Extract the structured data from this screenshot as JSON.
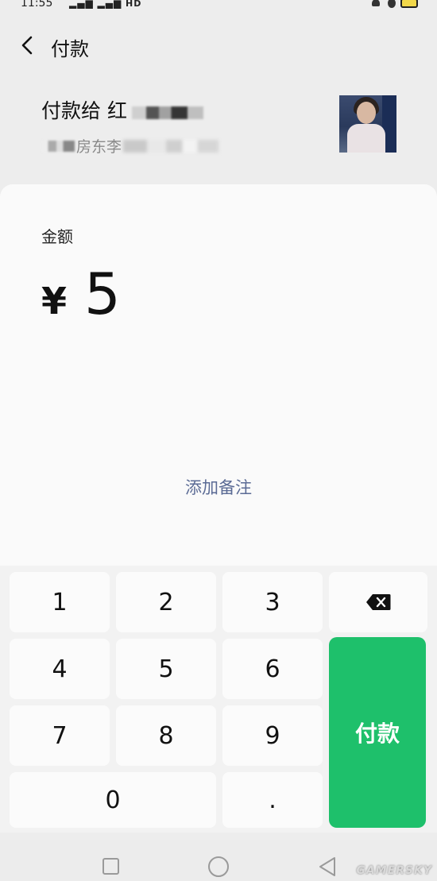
{
  "status_bar": {
    "time": "11:55",
    "signal": "ᴵıll ıll HD"
  },
  "header": {
    "title": "付款"
  },
  "payee": {
    "name": "付款给 红",
    "subtitle": "房东李"
  },
  "amount": {
    "label": "金额",
    "currency": "¥",
    "value": "5"
  },
  "note": {
    "add_label": "添加备注"
  },
  "keypad": {
    "k1": "1",
    "k2": "2",
    "k3": "3",
    "k4": "4",
    "k5": "5",
    "k6": "6",
    "k7": "7",
    "k8": "8",
    "k9": "9",
    "k0": "0",
    "dot": ".",
    "pay_label": "付款"
  },
  "watermark": "GAMERSKY",
  "colors": {
    "pay_button": "#1ec06b",
    "link": "#5b6b95",
    "background": "#ededed"
  }
}
